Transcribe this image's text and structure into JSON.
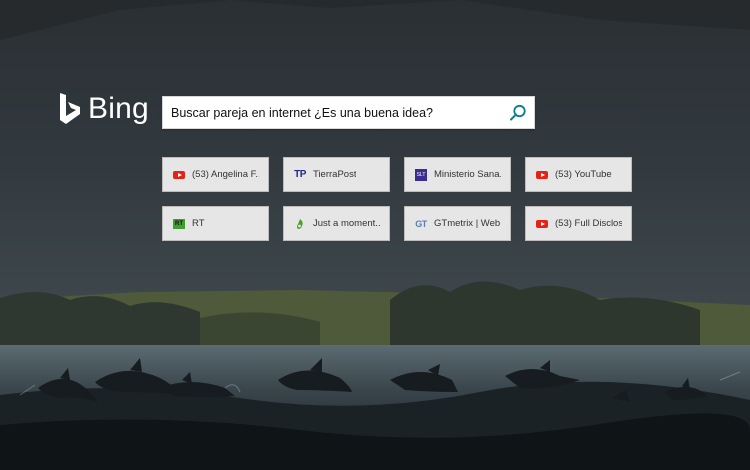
{
  "logo": {
    "text": "Bing"
  },
  "search": {
    "value": "Buscar pareja en internet ¿Es una buena idea?",
    "placeholder": ""
  },
  "tiles": [
    {
      "label": "(53) Angelina F...",
      "icon": "youtube-icon"
    },
    {
      "label": "TierraPost",
      "icon": "tierrapost-icon",
      "icon_text": "TP"
    },
    {
      "label": "Ministerio Sana...",
      "icon": "ministerio-icon",
      "icon_text": "SLT"
    },
    {
      "label": "(53) YouTube",
      "icon": "youtube-icon"
    },
    {
      "label": "RT",
      "icon": "rt-icon",
      "icon_text": "RT"
    },
    {
      "label": "Just a moment...",
      "icon": "cloudflare-icon"
    },
    {
      "label": "GTmetrix | Web...",
      "icon": "gtmetrix-icon",
      "icon_text": "GT"
    },
    {
      "label": "(53) Full Disclos...",
      "icon": "youtube-icon"
    }
  ],
  "colors": {
    "tile_bg": "#e6e6e6",
    "search_icon": "#0c7d8b",
    "youtube_red": "#e62117"
  }
}
